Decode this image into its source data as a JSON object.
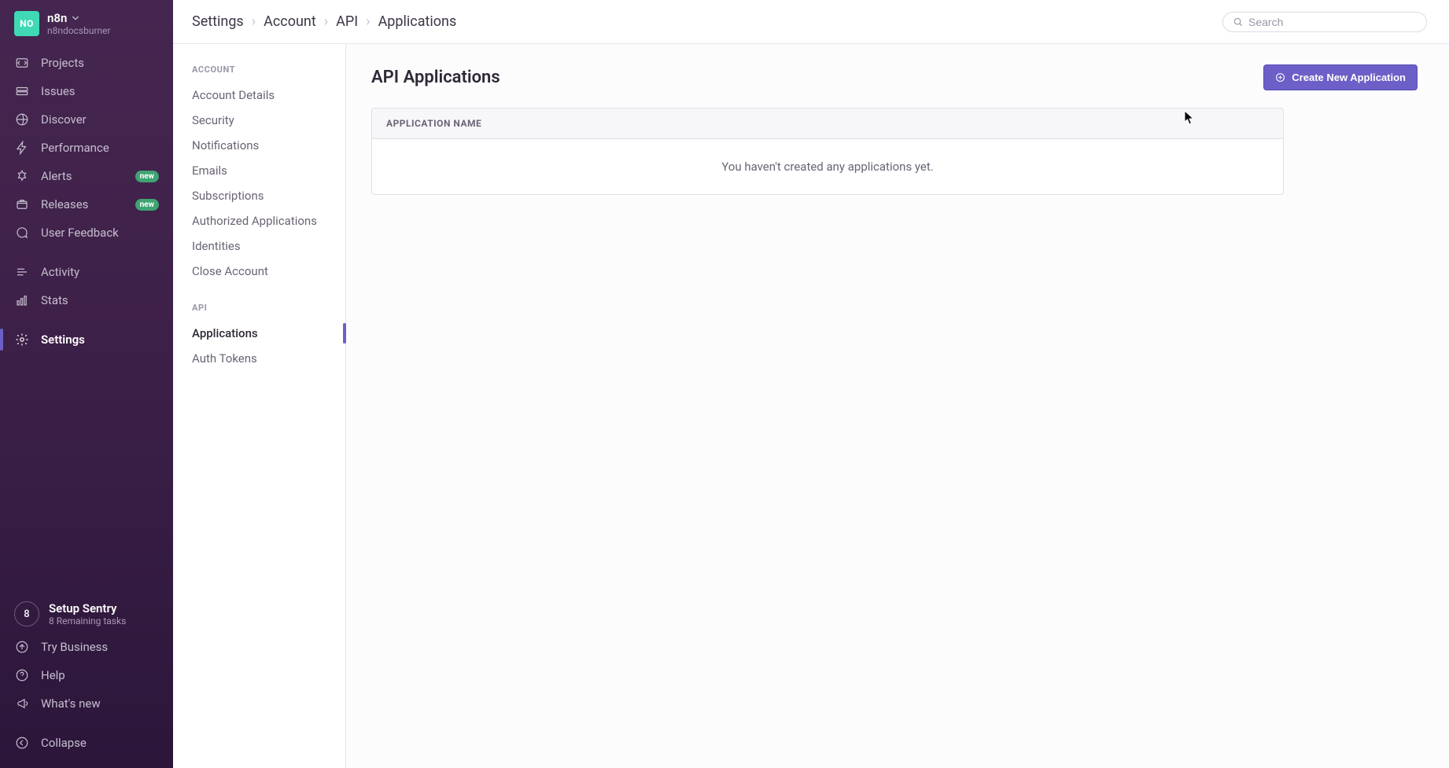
{
  "org": {
    "logo_text": "NO",
    "name": "n8n",
    "subtitle": "n8ndocsburner"
  },
  "sidebar": {
    "items": [
      {
        "label": "Projects",
        "icon": "projects-icon",
        "badge": null,
        "active": false
      },
      {
        "label": "Issues",
        "icon": "issues-icon",
        "badge": null,
        "active": false
      },
      {
        "label": "Discover",
        "icon": "discover-icon",
        "badge": null,
        "active": false
      },
      {
        "label": "Performance",
        "icon": "performance-icon",
        "badge": null,
        "active": false
      },
      {
        "label": "Alerts",
        "icon": "alerts-icon",
        "badge": "new",
        "active": false
      },
      {
        "label": "Releases",
        "icon": "releases-icon",
        "badge": "new",
        "active": false
      },
      {
        "label": "User Feedback",
        "icon": "user-feedback-icon",
        "badge": null,
        "active": false
      }
    ],
    "items2": [
      {
        "label": "Activity",
        "icon": "activity-icon",
        "badge": null,
        "active": false
      },
      {
        "label": "Stats",
        "icon": "stats-icon",
        "badge": null,
        "active": false
      }
    ],
    "items3": [
      {
        "label": "Settings",
        "icon": "settings-icon",
        "badge": null,
        "active": true
      }
    ],
    "setup": {
      "count": "8",
      "title": "Setup Sentry",
      "subtitle": "8 Remaining tasks"
    },
    "footer": [
      {
        "label": "Try Business",
        "icon": "try-business-icon"
      },
      {
        "label": "Help",
        "icon": "help-icon"
      },
      {
        "label": "What's new",
        "icon": "whats-new-icon"
      }
    ],
    "collapse_label": "Collapse"
  },
  "breadcrumbs": [
    "Settings",
    "Account",
    "API",
    "Applications"
  ],
  "search": {
    "placeholder": "Search"
  },
  "subnav": {
    "group1_title": "ACCOUNT",
    "group1": [
      "Account Details",
      "Security",
      "Notifications",
      "Emails",
      "Subscriptions",
      "Authorized Applications",
      "Identities",
      "Close Account"
    ],
    "group2_title": "API",
    "group2": [
      "Applications",
      "Auth Tokens"
    ],
    "active": "Applications"
  },
  "page": {
    "title": "API Applications",
    "create_button": "Create New Application",
    "table_header": "APPLICATION NAME",
    "empty_message": "You haven't created any applications yet."
  }
}
